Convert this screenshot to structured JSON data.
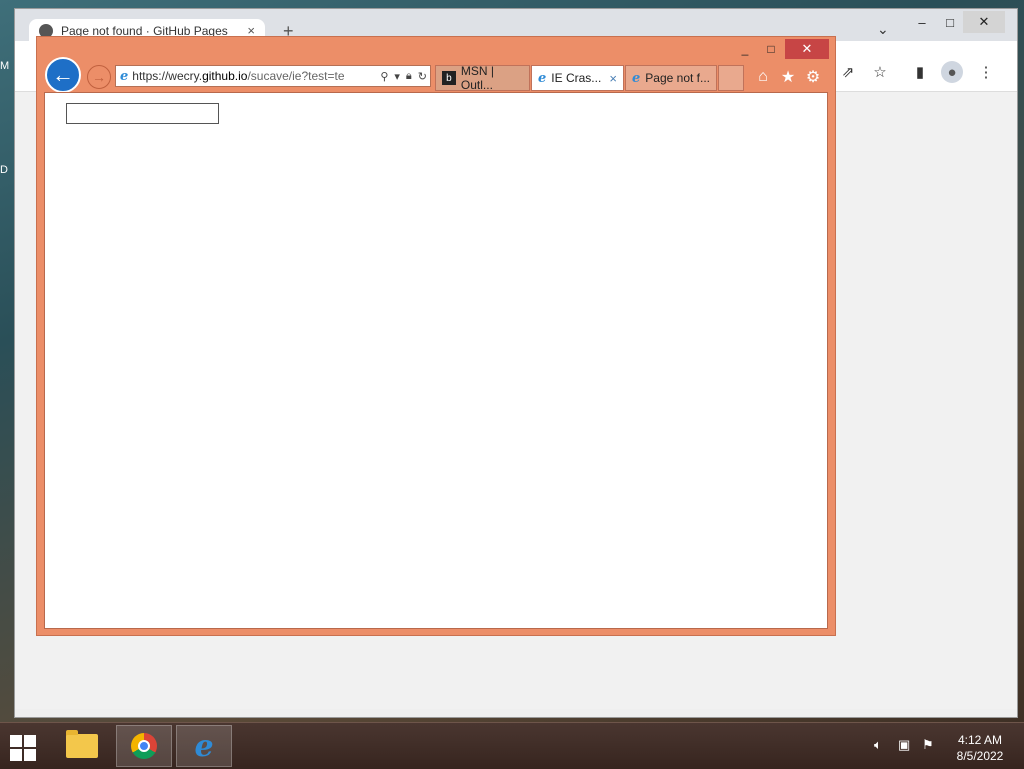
{
  "desktop": {
    "labels": [
      "M",
      "D"
    ]
  },
  "chrome": {
    "tab_title": "Page not found · GitHub Pages",
    "tab_close": "×",
    "new_tab": "+",
    "tab_search": "⌄",
    "window_controls": {
      "minimize": "–",
      "maximize": "□",
      "close": "✕"
    },
    "toolbar_icons": [
      "share-icon",
      "star-icon",
      "sidepanel-icon",
      "profile-icon",
      "menu-icon"
    ]
  },
  "ie": {
    "window_controls": {
      "minimize": "_",
      "maximize": "□",
      "close": "✕"
    },
    "address": {
      "domain_prefix": "https://wecry.",
      "domain": "github.io",
      "path": "/sucave/ie?test=te"
    },
    "tabs": [
      {
        "title": "MSN | Outl...",
        "icon": "msn-icon"
      },
      {
        "title": "IE Cras...",
        "icon": "ie-icon",
        "close": "×",
        "active": true
      },
      {
        "title": "Page not f...",
        "icon": "ie-icon"
      }
    ],
    "page": {
      "input_value": ""
    }
  },
  "taskbar": {
    "apps": [
      "file-explorer",
      "chrome",
      "internet-explorer"
    ],
    "clock": {
      "time": "4:12 AM",
      "date": "8/5/2022"
    }
  },
  "colors": {
    "ie_frame": "#ec8e68",
    "ie_close": "#c74545",
    "ie_back": "#1e6fc7"
  }
}
